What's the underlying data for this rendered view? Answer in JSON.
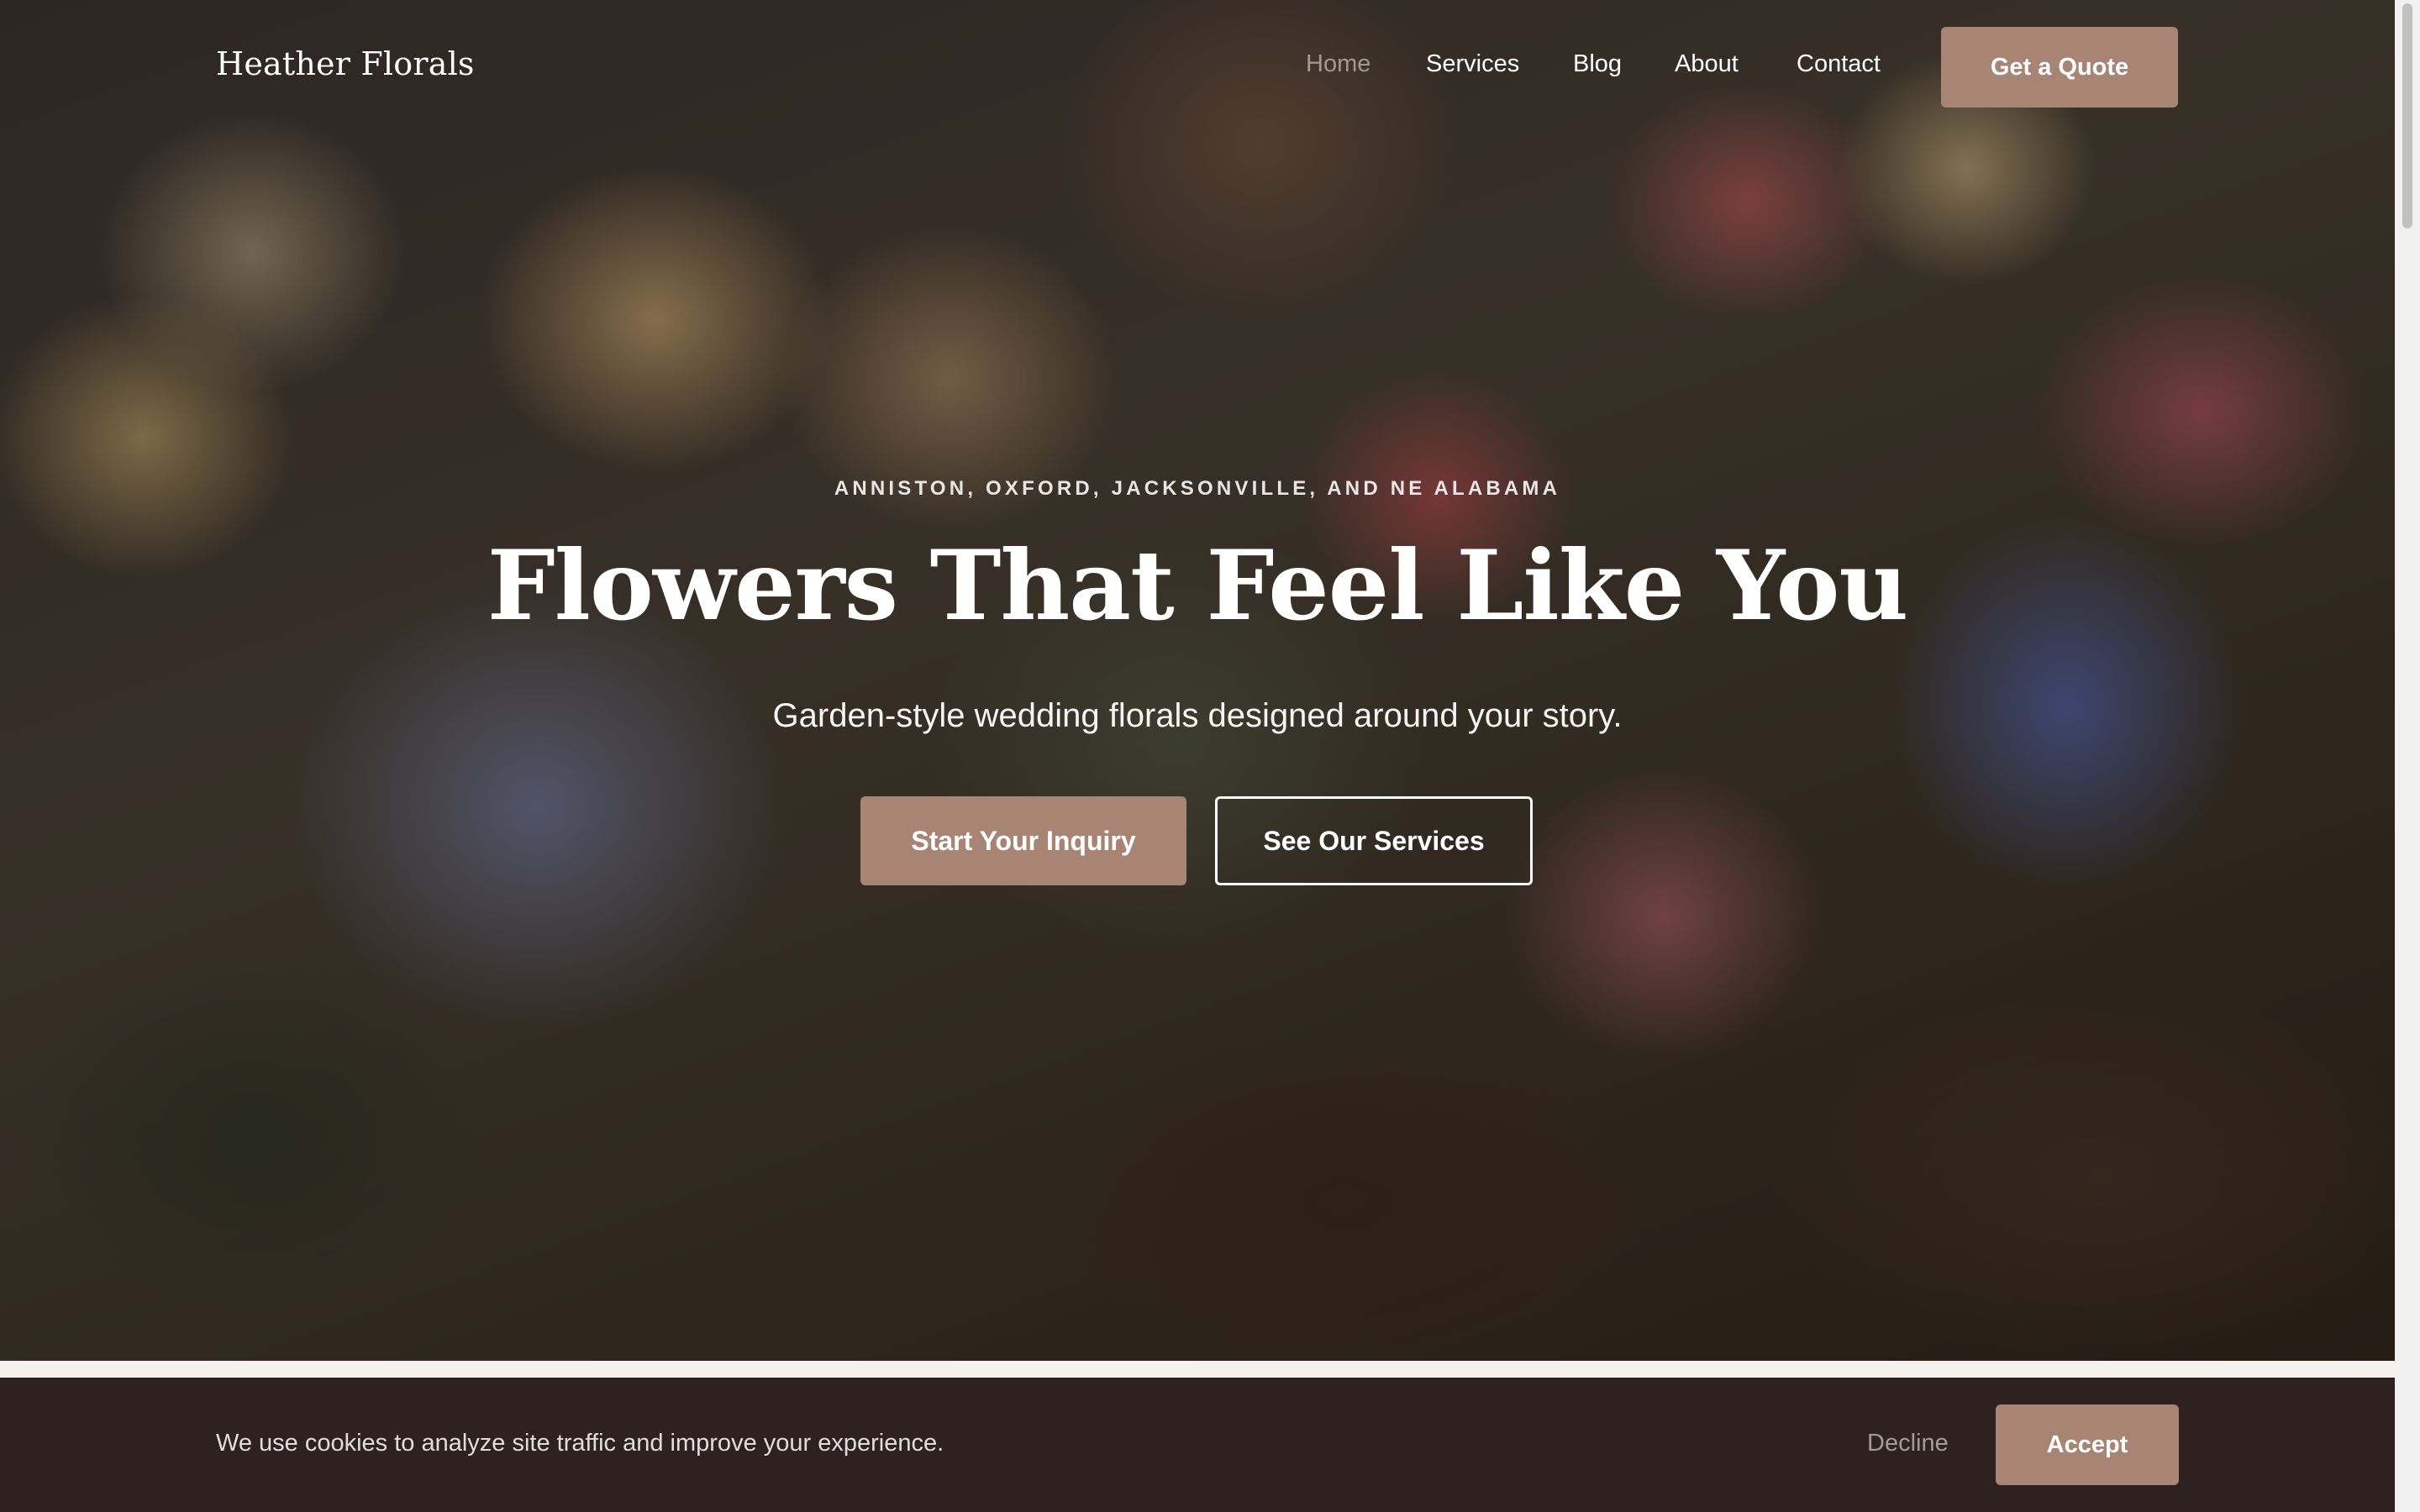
{
  "brand": {
    "name": "Heather Florals"
  },
  "nav": {
    "items": [
      {
        "label": "Home",
        "active": true
      },
      {
        "label": "Services",
        "active": false
      },
      {
        "label": "Blog",
        "active": false
      },
      {
        "label": "About",
        "active": false
      },
      {
        "label": "Contact",
        "active": false
      }
    ],
    "cta_label": "Get a Quote"
  },
  "hero": {
    "eyebrow": "ANNISTON, OXFORD, JACKSONVILLE, AND NE ALABAMA",
    "title": "Flowers That Feel Like You",
    "subtitle": "Garden-style wedding florals designed around your story.",
    "primary_button": "Start Your Inquiry",
    "secondary_button": "See Our Services"
  },
  "cookie_banner": {
    "message": "We use cookies to analyze site traffic and improve your experience.",
    "decline_label": "Decline",
    "accept_label": "Accept"
  },
  "colors": {
    "accent": "#a88474",
    "cookie_bg": "#2d2220",
    "page_bg": "#f6f1ec"
  }
}
